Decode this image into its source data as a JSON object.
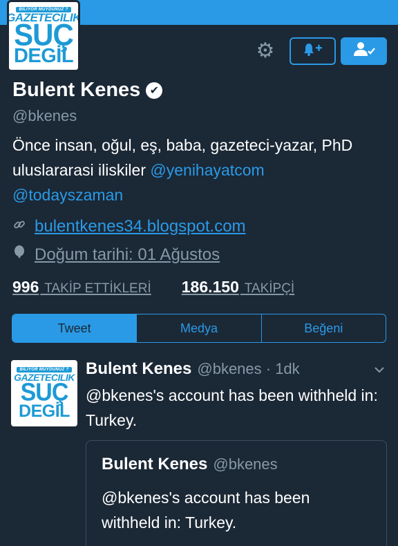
{
  "colors": {
    "accent": "#2a9ae6",
    "background": "#1b2836",
    "muted": "#8899a6"
  },
  "logo": {
    "top": "BILIYOR MUYDUNUZ ?",
    "line1": "GAZETECILIK",
    "line2": "SUÇ",
    "line3": "DEGİL"
  },
  "header": {
    "gear_icon": "gear-icon",
    "notify_icon": "bell-plus-icon",
    "follow_icon": "person-check-icon"
  },
  "profile": {
    "name": "Bulent Kenes",
    "verified_mark": "✔",
    "handle": "@bkenes",
    "bio_text": "Önce insan, oğul, eş, baba, gazeteci-yazar, PhD uluslararasi iliskiler ",
    "bio_mention1": "@yenihayatcom",
    "bio_mention2": "@todayszaman",
    "website": "bulentkenes34.blogspot.com",
    "birthday": "Doğum tarihi: 01 Ağustos"
  },
  "stats": {
    "following_count": "996",
    "following_label": "TAKİP ETTİKLERİ",
    "followers_count": "186.150",
    "followers_label": "TAKİPÇİ"
  },
  "tabs": [
    "Tweet",
    "Medya",
    "Beğeni"
  ],
  "tweet": {
    "name": "Bulent Kenes",
    "handle_time": "@bkenes · 1dk",
    "text": "@bkenes's account has been withheld in: Turkey.",
    "quote": {
      "name": "Bulent Kenes",
      "handle": "@bkenes",
      "text": "@bkenes's account has been withheld in: Turkey."
    }
  }
}
